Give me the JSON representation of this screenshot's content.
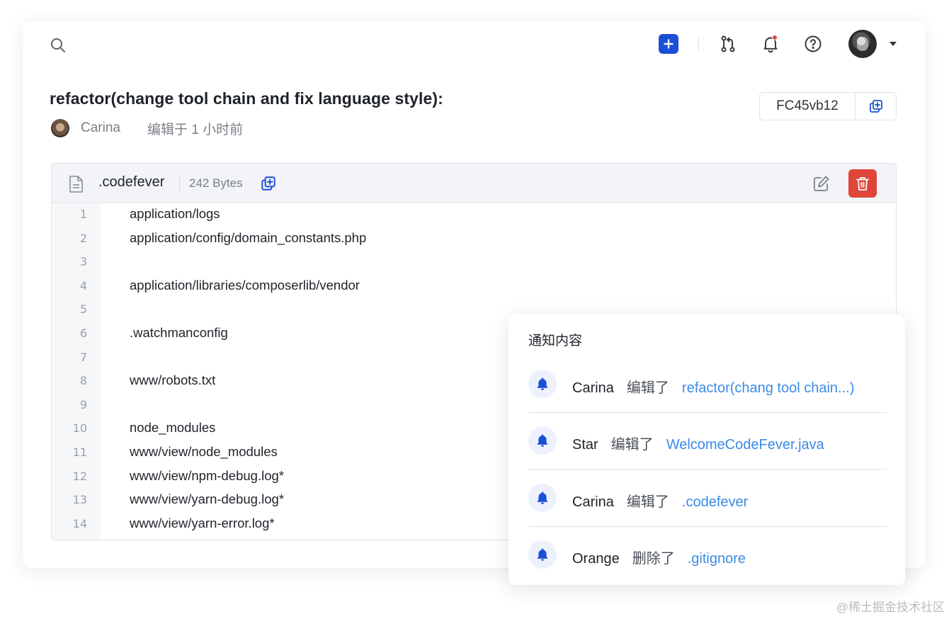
{
  "header": {
    "actions": [
      "search-icon",
      "add-icon",
      "pull-request-icon",
      "bell-icon",
      "help-icon",
      "avatar",
      "chevron-down-icon"
    ],
    "notification_dot_color": "#e5483c",
    "accent_color": "#1a4fd6"
  },
  "commit": {
    "title": "refactor(change tool chain and fix language style):",
    "author": "Carina",
    "edited_time": "编辑于 1 小时前",
    "hash": "FC45vb12"
  },
  "file": {
    "name": ".codefever",
    "size": "242 Bytes",
    "lines": [
      {
        "num": "1",
        "text": "application/logs"
      },
      {
        "num": "2",
        "text": "application/config/domain_constants.php"
      },
      {
        "num": "3",
        "text": ""
      },
      {
        "num": "4",
        "text": "application/libraries/composerlib/vendor"
      },
      {
        "num": "5",
        "text": ""
      },
      {
        "num": "6",
        "text": ".watchmanconfig"
      },
      {
        "num": "7",
        "text": ""
      },
      {
        "num": "8",
        "text": "www/robots.txt"
      },
      {
        "num": "9",
        "text": ""
      },
      {
        "num": "10",
        "text": "node_modules"
      },
      {
        "num": "11",
        "text": "www/view/node_modules"
      },
      {
        "num": "12",
        "text": "www/view/npm-debug.log*"
      },
      {
        "num": "13",
        "text": "www/view/yarn-debug.log*"
      },
      {
        "num": "14",
        "text": "www/view/yarn-error.log*"
      }
    ],
    "delete_color": "#e0453a"
  },
  "notifications": {
    "title": "通知内容",
    "items": [
      {
        "user": "Carina",
        "action": "编辑了",
        "target": "refactor(chang tool chain...)"
      },
      {
        "user": "Star",
        "action": "编辑了",
        "target": "WelcomeCodeFever.java"
      },
      {
        "user": "Carina",
        "action": "编辑了",
        "target": ".codefever"
      },
      {
        "user": "Orange",
        "action": "删除了",
        "target": ".gitignore"
      }
    ],
    "link_color": "#3b8be6"
  },
  "watermark": "@稀土掘金技术社区"
}
